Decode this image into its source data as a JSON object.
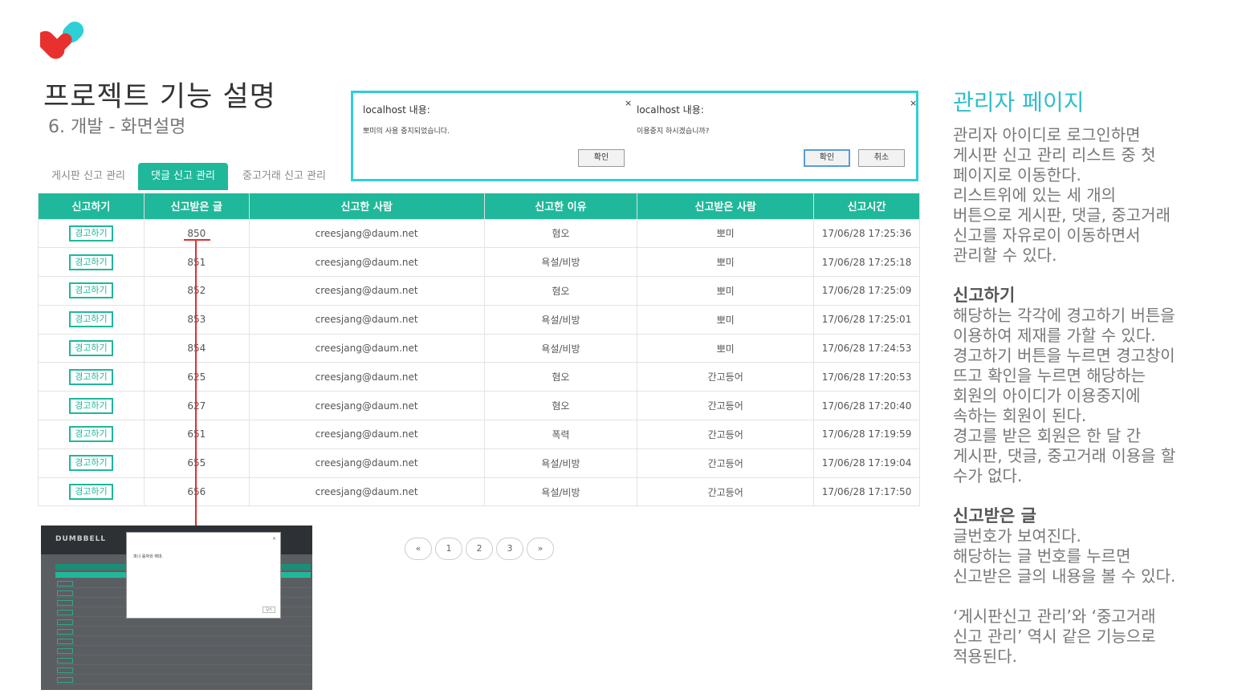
{
  "slide": {
    "title": "프로젝트 기능 설명",
    "subtitle": "6. 개발 - 화면설명"
  },
  "colors": {
    "accent": "#1fb89a",
    "logo_red": "#e8312f",
    "logo_cyan": "#2fcfd6",
    "dialog_border": "#2fcfd6",
    "heading": "#2fbfc9"
  },
  "tabs": [
    {
      "label": "게시판 신고 관리",
      "active": false
    },
    {
      "label": "댓글 신고 관리",
      "active": true
    },
    {
      "label": "중고거래 신고 관리",
      "active": false
    }
  ],
  "table": {
    "headers": [
      "신고하기",
      "신고받은 글",
      "신고한 사람",
      "신고한 이유",
      "신고받은 사람",
      "신고시간"
    ],
    "warn_label": "경고하기",
    "rows": [
      {
        "post": "850",
        "reporter": "creesjang@daum.net",
        "reason": "혐오",
        "target": "뽀미",
        "time": "17/06/28 17:25:36"
      },
      {
        "post": "851",
        "reporter": "creesjang@daum.net",
        "reason": "욕설/비방",
        "target": "뽀미",
        "time": "17/06/28 17:25:18"
      },
      {
        "post": "852",
        "reporter": "creesjang@daum.net",
        "reason": "혐오",
        "target": "뽀미",
        "time": "17/06/28 17:25:09"
      },
      {
        "post": "853",
        "reporter": "creesjang@daum.net",
        "reason": "욕설/비방",
        "target": "뽀미",
        "time": "17/06/28 17:25:01"
      },
      {
        "post": "854",
        "reporter": "creesjang@daum.net",
        "reason": "욕설/비방",
        "target": "뽀미",
        "time": "17/06/28 17:24:53"
      },
      {
        "post": "625",
        "reporter": "creesjang@daum.net",
        "reason": "혐오",
        "target": "간고등어",
        "time": "17/06/28 17:20:53"
      },
      {
        "post": "627",
        "reporter": "creesjang@daum.net",
        "reason": "혐오",
        "target": "간고등어",
        "time": "17/06/28 17:20:40"
      },
      {
        "post": "651",
        "reporter": "creesjang@daum.net",
        "reason": "폭력",
        "target": "간고등어",
        "time": "17/06/28 17:19:59"
      },
      {
        "post": "655",
        "reporter": "creesjang@daum.net",
        "reason": "욕설/비방",
        "target": "간고등어",
        "time": "17/06/28 17:19:04"
      },
      {
        "post": "656",
        "reporter": "creesjang@daum.net",
        "reason": "욕설/비방",
        "target": "간고등어",
        "time": "17/06/28 17:17:50"
      }
    ]
  },
  "dialogs": {
    "left": {
      "title": "localhost 내용:",
      "message": "뽀미의 사용 중지되었습니다.",
      "ok": "확인"
    },
    "right": {
      "title": "localhost 내용:",
      "message": "이용중지 하시겠습니까?",
      "ok": "확인",
      "cancel": "취소"
    }
  },
  "pagination": {
    "prev": "«",
    "pages": [
      "1",
      "2",
      "3"
    ],
    "next": "»"
  },
  "mini_screenshot": {
    "logo": "DUMBBELL",
    "popup_text": "피나 롤자와 재대.",
    "popup_btn": "닫기"
  },
  "right_panel": {
    "heading": "관리자 페이지",
    "intro": [
      "관리자 아이디로 로그인하면",
      "게시판 신고 관리 리스트 중 첫",
      "페이지로 이동한다.",
      "리스트위에 있는 세 개의",
      "버튼으로 게시판, 댓글, 중고거래",
      "신고를 자유로이 이동하면서",
      "관리할 수 있다."
    ],
    "section1_title": "신고하기",
    "section1": [
      "해당하는 각각에 경고하기 버튼을",
      "이용하여 제재를 가할 수 있다.",
      "경고하기 버튼을 누르면 경고창이",
      "뜨고 확인을 누르면 해당하는",
      "회원의 아이디가 이용중지에",
      "속하는 회원이 된다.",
      "경고를 받은 회원은 한 달 간",
      "게시판, 댓글, 중고거래 이용을 할",
      "수가 없다."
    ],
    "section2_title": "신고받은 글",
    "section2": [
      "글번호가 보여진다.",
      "해당하는 글 번호를 누르면",
      "신고받은 글의 내용을 볼 수 있다."
    ],
    "note": [
      "‘게시판신고 관리’와 ‘중고거래",
      "신고 관리’ 역시 같은 기능으로",
      "적용된다."
    ]
  }
}
